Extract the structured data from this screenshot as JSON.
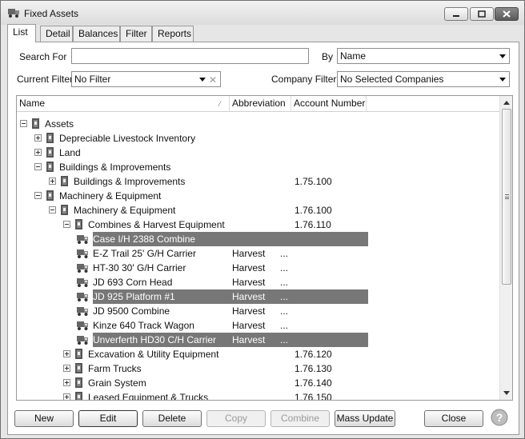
{
  "window": {
    "title": "Fixed Assets",
    "controls": {
      "minimize": "minimize-icon",
      "maximize": "maximize-icon",
      "close": "close-icon"
    }
  },
  "tabs": [
    {
      "label": "List"
    },
    {
      "label": "Detail"
    },
    {
      "label": "Balances"
    },
    {
      "label": "Filter"
    },
    {
      "label": "Reports"
    }
  ],
  "search": {
    "label": "Search For",
    "value": ""
  },
  "by": {
    "label": "By",
    "value": "Name"
  },
  "current_filter": {
    "label": "Current Filter",
    "value": "No Filter"
  },
  "company_filter": {
    "label": "Company Filter",
    "value": "No Selected Companies"
  },
  "grid": {
    "columns": [
      "Name",
      "Abbreviation",
      "Account Number"
    ],
    "rows": [
      {
        "name": "Assets",
        "abbr": "",
        "acct": "",
        "expander": "minus",
        "icon": "book"
      },
      {
        "name": "Depreciable Livestock Inventory",
        "abbr": "",
        "acct": "",
        "expander": "plus",
        "icon": "book"
      },
      {
        "name": "Land",
        "abbr": "",
        "acct": "",
        "expander": "plus",
        "icon": "book"
      },
      {
        "name": "Buildings & Improvements",
        "abbr": "",
        "acct": "",
        "expander": "minus",
        "icon": "book"
      },
      {
        "name": "Buildings & Improvements",
        "abbr": "",
        "acct": "1.75.100",
        "expander": "plus",
        "icon": "book"
      },
      {
        "name": "Machinery & Equipment",
        "abbr": "",
        "acct": "",
        "expander": "minus",
        "icon": "book"
      },
      {
        "name": "Machinery & Equipment",
        "abbr": "",
        "acct": "1.76.100",
        "expander": "minus",
        "icon": "book"
      },
      {
        "name": "Combines & Harvest Equipment",
        "abbr": "",
        "acct": "1.76.110",
        "expander": "minus",
        "icon": "book"
      },
      {
        "name": "Case I/H 2388 Combine",
        "abbr": "",
        "acct": "",
        "expander": "none",
        "icon": "truck",
        "selected": true
      },
      {
        "name": "E-Z Trail 25' G/H Carrier",
        "abbr": "Harvest",
        "acct": "...",
        "expander": "none",
        "icon": "truck"
      },
      {
        "name": "HT-30 30' G/H Carrier",
        "abbr": "Harvest",
        "acct": "...",
        "expander": "none",
        "icon": "truck"
      },
      {
        "name": "JD 693 Corn Head",
        "abbr": "Harvest",
        "acct": "...",
        "expander": "none",
        "icon": "truck"
      },
      {
        "name": "JD 925 Platform #1",
        "abbr": "Harvest",
        "acct": "...",
        "expander": "none",
        "icon": "truck",
        "selected": true
      },
      {
        "name": "JD 9500 Combine",
        "abbr": "Harvest",
        "acct": "...",
        "expander": "none",
        "icon": "truck"
      },
      {
        "name": "Kinze 640 Track Wagon",
        "abbr": "Harvest",
        "acct": "...",
        "expander": "none",
        "icon": "truck"
      },
      {
        "name": "Unverferth HD30 C/H Carrier",
        "abbr": "Harvest",
        "acct": "...",
        "expander": "none",
        "icon": "truck",
        "selected": true
      },
      {
        "name": "Excavation & Utility Equipment",
        "abbr": "",
        "acct": "1.76.120",
        "expander": "plus",
        "icon": "book"
      },
      {
        "name": "Farm Trucks",
        "abbr": "",
        "acct": "1.76.130",
        "expander": "plus",
        "icon": "book"
      },
      {
        "name": "Grain System",
        "abbr": "",
        "acct": "1.76.140",
        "expander": "plus",
        "icon": "book"
      },
      {
        "name": "Leased Equipment & Trucks",
        "abbr": "",
        "acct": "1.76.150",
        "expander": "plus",
        "icon": "book"
      }
    ]
  },
  "buttons": {
    "new": "New",
    "edit": "Edit",
    "delete": "Delete",
    "copy": "Copy",
    "combine": "Combine",
    "mass_update": "Mass Update",
    "close": "Close"
  }
}
